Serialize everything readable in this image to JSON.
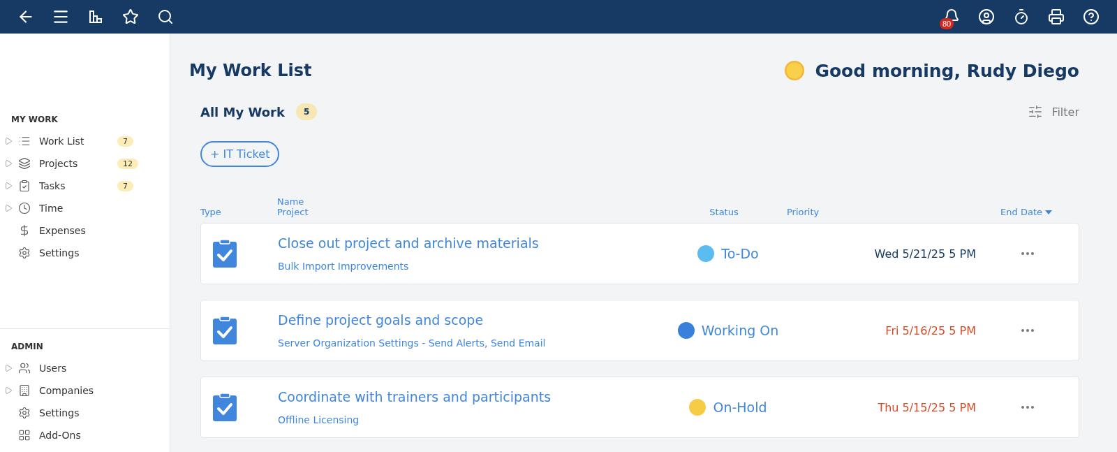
{
  "topbar": {
    "notifications": "80"
  },
  "sidebar": {
    "sections": [
      {
        "title": "MY WORK",
        "items": [
          {
            "label": "Work List",
            "expandable": true,
            "count": "7"
          },
          {
            "label": "Projects",
            "expandable": true,
            "count": "12"
          },
          {
            "label": "Tasks",
            "expandable": true,
            "count": "7"
          },
          {
            "label": "Time",
            "expandable": true
          },
          {
            "label": "Expenses",
            "expandable": false
          },
          {
            "label": "Settings",
            "expandable": false
          }
        ]
      },
      {
        "title": "ADMIN",
        "items": [
          {
            "label": "Users",
            "expandable": true
          },
          {
            "label": "Companies",
            "expandable": true
          },
          {
            "label": "Settings",
            "expandable": false
          },
          {
            "label": "Add-Ons",
            "expandable": false
          }
        ]
      }
    ]
  },
  "page": {
    "title": "My Work List",
    "greeting": "Good morning, Rudy Diego",
    "section": "All My Work",
    "section_count": "5",
    "filter": "Filter",
    "new_button": "+ IT Ticket"
  },
  "table": {
    "columns": [
      {
        "label": "Type"
      },
      {
        "label": "Name",
        "sublabel": "Project"
      },
      {
        "label": "Status"
      },
      {
        "label": "Priority"
      },
      {
        "label": "End Date",
        "sorted": true
      }
    ],
    "rows": [
      {
        "name": "Close out project and archive materials",
        "project": "Bulk Import Improvements",
        "status": "To-Do",
        "color": "#5bbcf0",
        "end_date": "Wed 5/21/25 5 PM",
        "overdue": false
      },
      {
        "name": "Define project goals and scope",
        "project": "Server Organization Settings - Send Alerts, Send Email",
        "status": "Working On",
        "color": "#3a7fdc",
        "end_date": "Fri 5/16/25 5 PM",
        "overdue": true
      },
      {
        "name": "Coordinate with trainers and participants",
        "project": "Offline Licensing",
        "status": "On-Hold",
        "color": "#f5cc45",
        "end_date": "Thu 5/15/25 5 PM",
        "overdue": true
      }
    ]
  }
}
